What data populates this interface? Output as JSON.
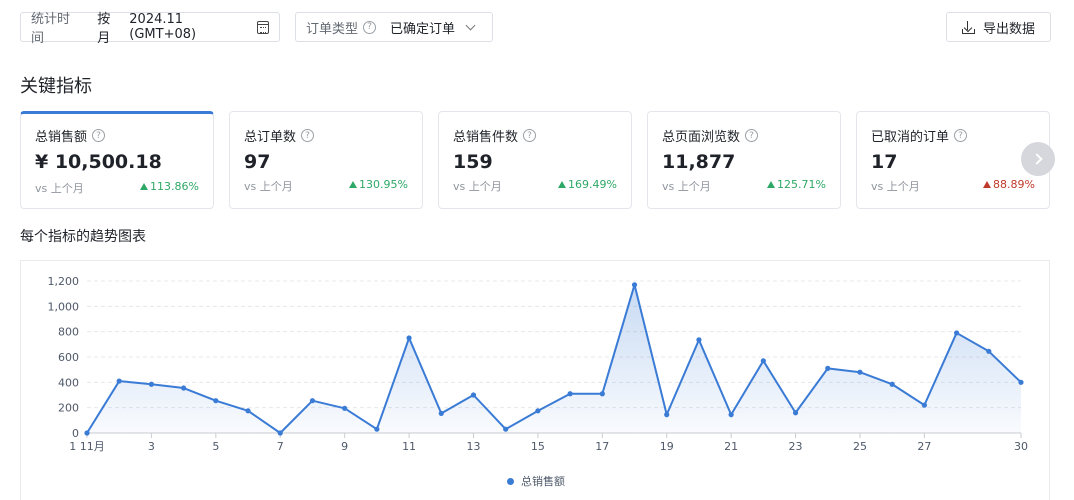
{
  "filters": {
    "time_label": "统计时间",
    "time_mode": "按月",
    "time_value": "2024.11 (GMT+08)",
    "order_type_label": "订单类型",
    "order_type_value": "已确定订单"
  },
  "export_label": "导出数据",
  "section_title": "关键指标",
  "metrics": [
    {
      "title": "总销售额",
      "value": "¥ 10,500.18",
      "vs": "vs 上个月",
      "change": "113.86%",
      "direction": "up",
      "active": true
    },
    {
      "title": "总订单数",
      "value": "97",
      "vs": "vs 上个月",
      "change": "130.95%",
      "direction": "up"
    },
    {
      "title": "总销售件数",
      "value": "159",
      "vs": "vs 上个月",
      "change": "169.49%",
      "direction": "up"
    },
    {
      "title": "总页面浏览数",
      "value": "11,877",
      "vs": "vs 上个月",
      "change": "125.71%",
      "direction": "up"
    },
    {
      "title": "已取消的订单",
      "value": "17",
      "vs": "vs 上个月",
      "change": "88.89%",
      "direction": "up-red"
    }
  ],
  "chart_title": "每个指标的趋势图表",
  "colors": {
    "accent": "#3a7bd5",
    "up": "#2ea866",
    "down": "#c0392b"
  },
  "chart_data": {
    "type": "area",
    "x": [
      1,
      2,
      3,
      4,
      5,
      6,
      7,
      8,
      9,
      10,
      11,
      12,
      13,
      14,
      15,
      16,
      17,
      18,
      19,
      20,
      21,
      22,
      23,
      24,
      25,
      26,
      27,
      28,
      29,
      30
    ],
    "x_tick_labels": [
      "1 11月",
      "3",
      "5",
      "7",
      "9",
      "11",
      "13",
      "15",
      "17",
      "19",
      "21",
      "23",
      "25",
      "27",
      "30"
    ],
    "x_tick_values": [
      1,
      3,
      5,
      7,
      9,
      11,
      13,
      15,
      17,
      19,
      21,
      23,
      25,
      27,
      30
    ],
    "series": [
      {
        "name": "总销售额",
        "values": [
          0,
          410,
          385,
          355,
          255,
          175,
          0,
          255,
          195,
          30,
          750,
          155,
          300,
          30,
          175,
          310,
          310,
          1170,
          145,
          735,
          145,
          570,
          160,
          510,
          480,
          385,
          220,
          790,
          645,
          400
        ]
      }
    ],
    "ylim": [
      0,
      1200
    ],
    "y_ticks": [
      0,
      200,
      400,
      600,
      800,
      "1,000",
      "1,200"
    ],
    "y_tick_values": [
      0,
      200,
      400,
      600,
      800,
      1000,
      1200
    ],
    "legend_position": "bottom-center",
    "grid": true
  }
}
